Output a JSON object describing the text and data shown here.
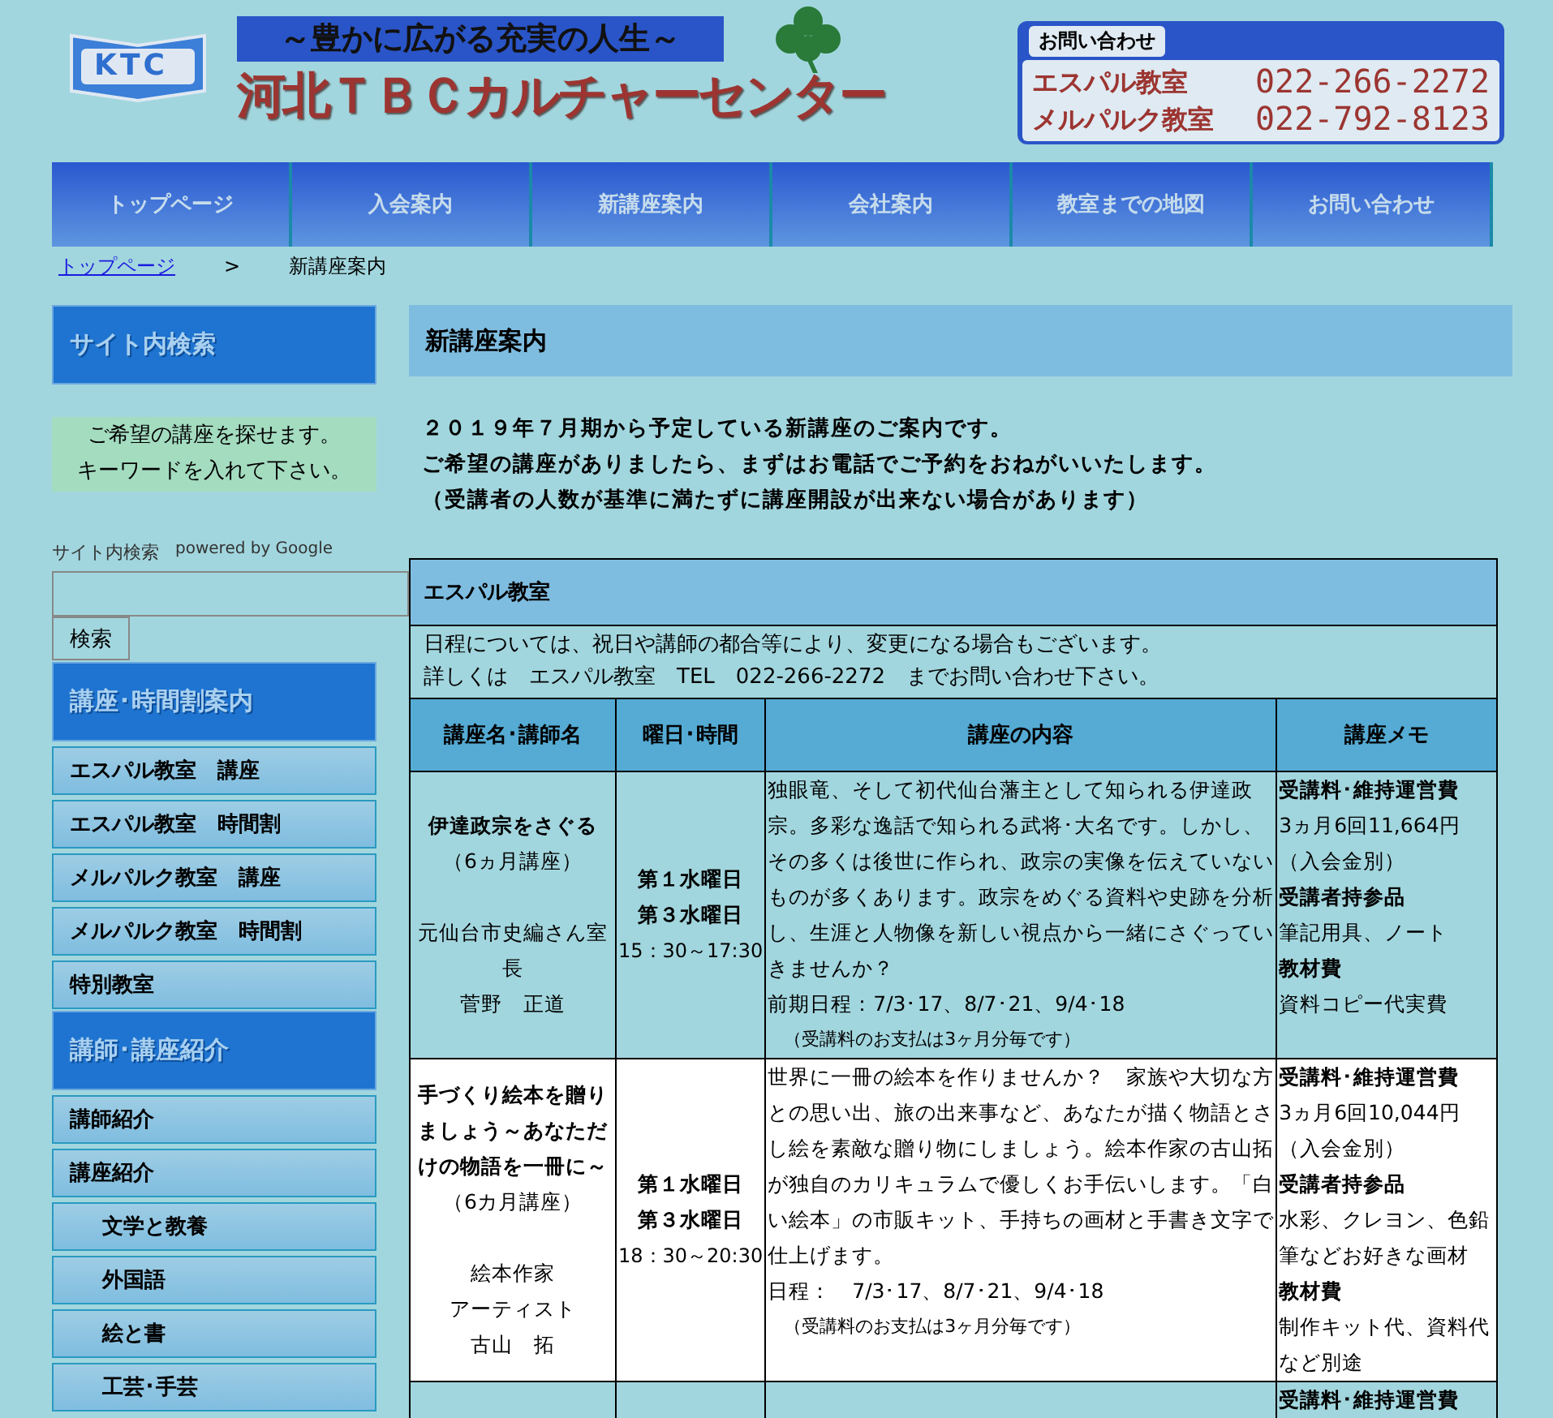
{
  "header": {
    "logo": "KTC",
    "tagline": "～豊かに広がる充実の人生～",
    "title": "河北ＴＢＣカルチャーセンター",
    "contact": {
      "label": "お問い合わせ",
      "entries": [
        {
          "name": "エスパル教室",
          "phone": "022-266-2272"
        },
        {
          "name": "メルパルク教室",
          "phone": "022-792-8123"
        }
      ]
    }
  },
  "nav": [
    "トップページ",
    "入会案内",
    "新講座案内",
    "会社案内",
    "教室までの地図",
    "お問い合わせ"
  ],
  "breadcrumb": {
    "link": "トップページ",
    "separator": ">",
    "current": "新講座案内"
  },
  "sidebar": {
    "search_heading": "サイト内検索",
    "search_note": [
      "ご希望の講座を探せます。",
      "キーワードを入れて下さい。"
    ],
    "search_label": "サイト内検索",
    "powered_by": "powered by Google",
    "search_button": "検索",
    "sections": [
      {
        "heading": "講座･時間割案内",
        "items": [
          {
            "label": "エスパル教室　講座"
          },
          {
            "label": "エスパル教室　時間割"
          },
          {
            "label": "メルパルク教室　講座"
          },
          {
            "label": "メルパルク教室　時間割"
          },
          {
            "label": "特別教室"
          }
        ]
      },
      {
        "heading": "講師･講座紹介",
        "items": [
          {
            "label": "講師紹介"
          },
          {
            "label": "講座紹介",
            "children": [
              {
                "label": "文学と教養"
              },
              {
                "label": "外国語"
              },
              {
                "label": "絵と書"
              },
              {
                "label": "工芸･手芸"
              }
            ]
          }
        ]
      }
    ]
  },
  "main": {
    "heading": "新講座案内",
    "intro": [
      "２０１９年７月期から予定している新講座のご案内です。",
      "ご希望の講座がありましたら、まずはお電話でご予約をおねがいいたします。",
      "（受講者の人数が基準に満たずに講座開設が出来ない場合があります）"
    ],
    "table": {
      "title": "エスパル教室",
      "notes": [
        "日程については、祝日や講師の都合等により、変更になる場合もございます。",
        "詳しくは　エスパル教室　TEL　022-266-2272　までお問い合わせ下さい。"
      ],
      "columns": [
        "講座名･講師名",
        "曜日･時間",
        "講座の内容",
        "講座メモ"
      ],
      "rows": [
        {
          "highlighted": false,
          "name": "伊達政宗をさぐる",
          "duration": "（6ヵ月講座）",
          "lecturer": [
            "元仙台市史編さん室長",
            "菅野　正道"
          ],
          "days": [
            "第１水曜日",
            "第３水曜日"
          ],
          "time": "15：30～17:30",
          "content": "独眼竜、そして初代仙台藩主として知られる伊達政宗。多彩な逸話で知られる武将･大名です。しかし、その多くは後世に作られ、政宗の実像を伝えていないものが多くあります。政宗をめぐる資料や史跡を分析し、生涯と人物像を新しい視点から一緒にさぐっていきませんか？",
          "dates": "前期日程：7/3･17、8/7･21、9/4･18",
          "payment": "（受講料のお支払は3ヶ月分毎です）",
          "memo": [
            {
              "kind": "head",
              "text": "受講料･維持運営費"
            },
            {
              "kind": "text",
              "text": "3ヵ月6回11,664円"
            },
            {
              "kind": "text",
              "text": "（入会金別）"
            },
            {
              "kind": "head",
              "text": "受講者持参品"
            },
            {
              "kind": "text",
              "text": "筆記用具、ノート"
            },
            {
              "kind": "head",
              "text": "教材費"
            },
            {
              "kind": "text",
              "text": "資料コピー代実費"
            }
          ]
        },
        {
          "highlighted": true,
          "name": "手づくり絵本を贈りましょう～あなただけの物語を一冊に～",
          "duration": "（6カ月講座）",
          "lecturer": [
            "絵本作家",
            "アーティスト",
            "古山　拓"
          ],
          "days": [
            "第１水曜日",
            "第３水曜日"
          ],
          "time": "18：30～20:30",
          "content": "世界に一冊の絵本を作りませんか？　家族や大切な方との思い出、旅の出来事など、あなたが描く物語とさし絵を素敵な贈り物にしましょう。絵本作家の古山拓が独自のカリキュラムで優しくお手伝いします。「白い絵本」の市販キット、手持ちの画材と手書き文字で仕上げます。",
          "dates": "日程：　7/3･17、8/7･21、9/4･18",
          "payment": "（受講料のお支払は3ヶ月分毎です）",
          "memo": [
            {
              "kind": "head",
              "text": "受講料･維持運営費"
            },
            {
              "kind": "text",
              "text": "3ヵ月6回10,044円"
            },
            {
              "kind": "text",
              "text": "（入会金別）"
            },
            {
              "kind": "head",
              "text": "受講者持参品"
            },
            {
              "kind": "text",
              "text": "水彩、クレヨン、色鉛筆などお好きな画材"
            },
            {
              "kind": "head",
              "text": "教材費"
            },
            {
              "kind": "text",
              "text": "制作キット代、資料代など別途"
            }
          ]
        },
        {
          "highlighted": false,
          "memo": [
            {
              "kind": "head",
              "text": "受講料･維持運営費"
            }
          ]
        }
      ]
    }
  }
}
